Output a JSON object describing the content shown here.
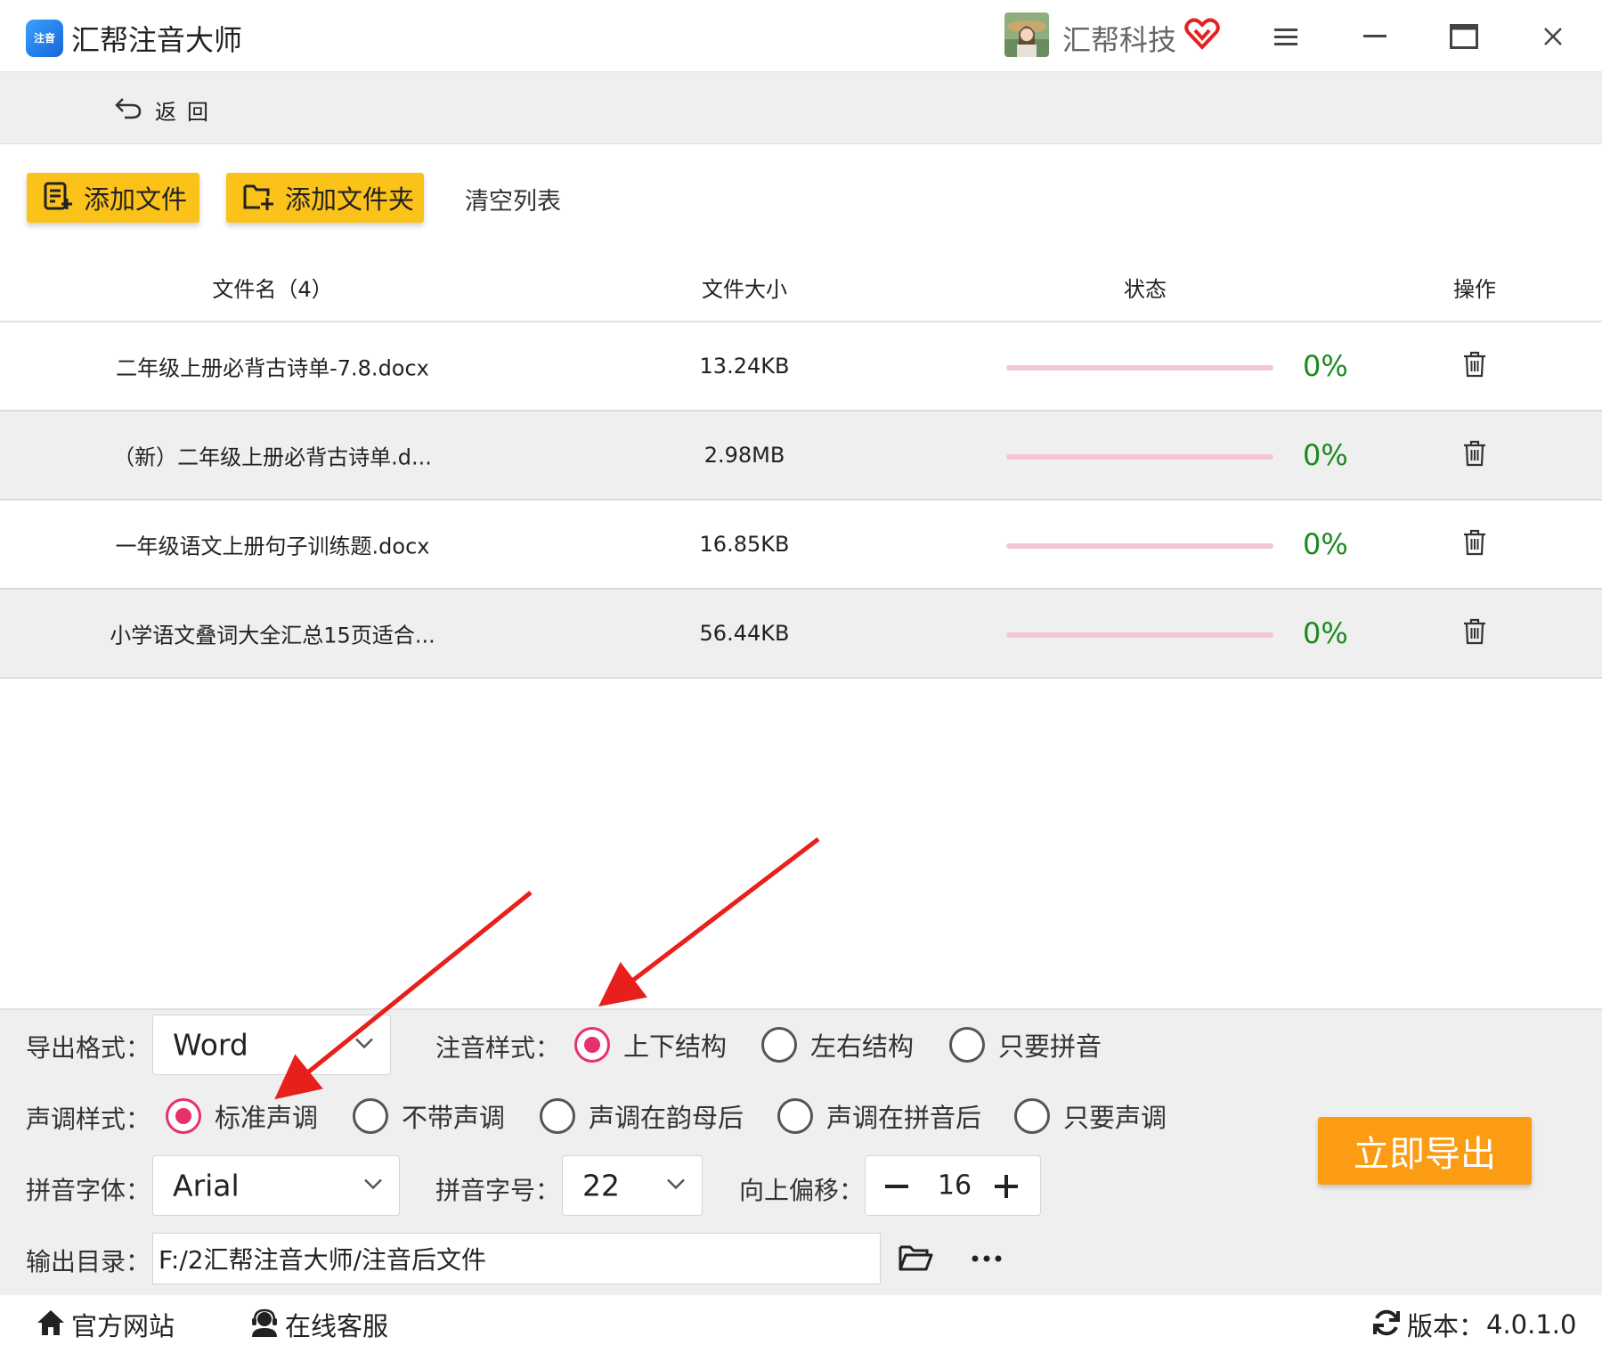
{
  "window": {
    "app_title": "汇帮注音大师",
    "logo_text": "注音",
    "company": "汇帮科技",
    "accent_color": "#fbc21a",
    "export_color": "#fb9c14"
  },
  "backbar": {
    "back_label": "返回"
  },
  "toolbar": {
    "add_file": "添加文件",
    "add_folder": "添加文件夹",
    "clear_list": "清空列表"
  },
  "table": {
    "headers": {
      "name": "文件名（4）",
      "size": "文件大小",
      "status": "状态",
      "action": "操作"
    },
    "rows": [
      {
        "name": "二年级上册必背古诗单-7.8.docx",
        "size": "13.24KB",
        "progress": 0,
        "percent": "0%"
      },
      {
        "name": "（新）二年级上册必背古诗单.d...",
        "size": "2.98MB",
        "progress": 0,
        "percent": "0%"
      },
      {
        "name": "一年级语文上册句子训练题.docx",
        "size": "16.85KB",
        "progress": 0,
        "percent": "0%"
      },
      {
        "name": "小学语文叠词大全汇总15页适合...",
        "size": "56.44KB",
        "progress": 0,
        "percent": "0%"
      }
    ]
  },
  "settings": {
    "export_format_label": "导出格式：",
    "export_format_value": "Word",
    "pinyin_style_label": "注音样式：",
    "pinyin_style_options": [
      "上下结构",
      "左右结构",
      "只要拼音"
    ],
    "pinyin_style_selected": "上下结构",
    "tone_style_label": "声调样式：",
    "tone_style_options": [
      "标准声调",
      "不带声调",
      "声调在韵母后",
      "声调在拼音后",
      "只要声调"
    ],
    "tone_style_selected": "标准声调",
    "font_label": "拼音字体：",
    "font_value": "Arial",
    "size_label": "拼音字号：",
    "size_value": "22",
    "offset_label": "向上偏移：",
    "offset_value": "16",
    "output_dir_label": "输出目录：",
    "output_dir_value": "F:/2汇帮注音大师/注音后文件",
    "export_button": "立即导出"
  },
  "footer": {
    "website": "官方网站",
    "support": "在线客服",
    "version_label": "版本：",
    "version_value": "4.0.1.0"
  },
  "icons": [
    "back-icon",
    "add-file-icon",
    "add-folder-icon",
    "trash-icon",
    "menu-icon",
    "minimize-icon",
    "maximize-icon",
    "close-icon",
    "vip-heart-icon",
    "folder-icon",
    "more-icon",
    "home-icon",
    "headset-user-icon",
    "refresh-icon",
    "chevron-down-icon"
  ]
}
